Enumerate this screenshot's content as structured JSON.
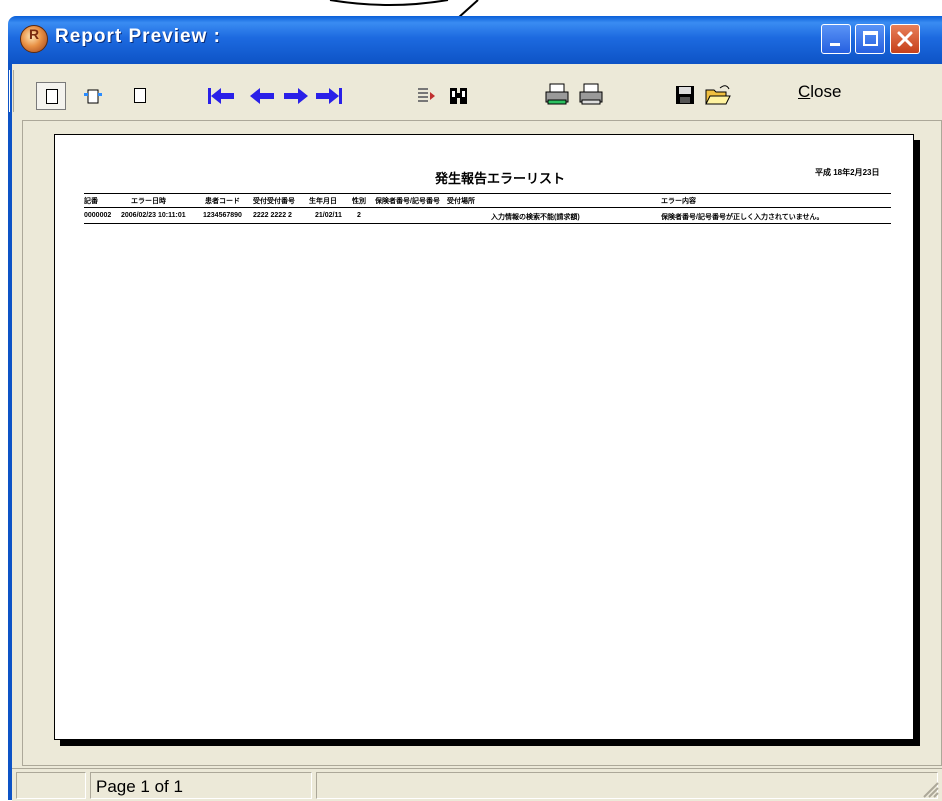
{
  "window": {
    "title": "Report Preview :",
    "app_icon_letter": "R",
    "titlebar_color": "#0d53c6"
  },
  "toolbar": {
    "close_label_prefix": "",
    "close_label_accel": "C",
    "close_label_rest": "lose",
    "icons": [
      "single-page-icon",
      "multi-page-icon",
      "two-page-icon",
      "first-page-icon",
      "previous-page-icon",
      "next-page-icon",
      "last-page-icon",
      "goto-page-icon",
      "find-icon",
      "print-setup-icon",
      "print-icon",
      "save-icon",
      "open-icon"
    ],
    "arrow_color": "#2a20e8"
  },
  "report": {
    "title": "発生報告エラーリスト",
    "date": "平成 18年2月23日",
    "columns": [
      "記番",
      "エラー日時",
      "患者コード",
      "受付受付番号",
      "生年月日",
      "性別",
      "保険者番号/記号番号",
      "受付場所",
      "エラー内容"
    ],
    "row": [
      "0000002",
      "2006/02/23 10:11:01",
      "1234567890",
      "2222 2222 2",
      "21/02/11",
      "2",
      "",
      "入力情報の検索不能(請求額)",
      "保険者番号/記号番号が正しく入力されていません。"
    ]
  },
  "status": {
    "page_text": "Page 1 of 1"
  }
}
